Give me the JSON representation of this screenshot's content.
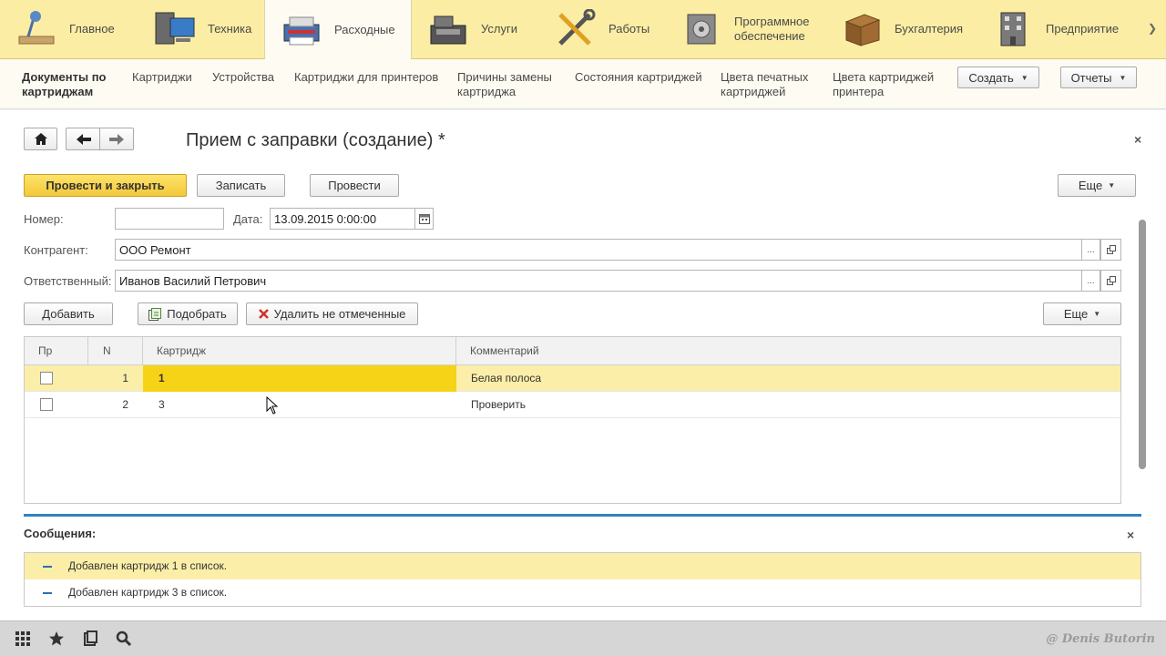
{
  "sections": [
    {
      "label": "Главное",
      "icon": "desk-lamp-icon"
    },
    {
      "label": "Техника",
      "icon": "computer-icon"
    },
    {
      "label": "Расходные",
      "icon": "printer-icon",
      "active": true
    },
    {
      "label": "Услуги",
      "icon": "cash-register-icon"
    },
    {
      "label": "Работы",
      "icon": "tools-icon"
    },
    {
      "label": "Программное\nобеспечение",
      "icon": "software-icon"
    },
    {
      "label": "Бухгалтерия",
      "icon": "archive-box-icon"
    },
    {
      "label": "Предприятие",
      "icon": "building-icon"
    }
  ],
  "navbar": {
    "items": [
      {
        "label": "Документы по\nкартриджам",
        "bold": true
      },
      {
        "label": "Картриджи"
      },
      {
        "label": "Устройства"
      },
      {
        "label": "Картриджи для принтеров"
      },
      {
        "label": "Причины замены\nкартриджа"
      },
      {
        "label": "Состояния картриджей"
      },
      {
        "label": "Цвета печатных\nкартриджей"
      },
      {
        "label": "Цвета картриджей\nпринтера"
      }
    ],
    "create_label": "Создать",
    "reports_label": "Отчеты"
  },
  "form": {
    "title": "Прием с заправки (создание) *",
    "post_close_label": "Провести и закрыть",
    "save_label": "Записать",
    "post_label": "Провести",
    "more_label": "Еще",
    "number_label": "Номер:",
    "number_value": "",
    "date_label": "Дата:",
    "date_value": "13.09.2015  0:00:00",
    "counterparty_label": "Контрагент:",
    "counterparty_value": "ООО Ремонт",
    "responsible_label": "Ответственный:",
    "responsible_value": "Иванов Василий Петрович",
    "add_label": "Добавить",
    "pick_label": "Подобрать",
    "delete_unmarked_label": "Удалить не отмеченные",
    "table_more_label": "Еще",
    "ellipsis": "..."
  },
  "table": {
    "columns": [
      "Пр",
      "N",
      "Картридж",
      "Комментарий"
    ],
    "rows": [
      {
        "checked": false,
        "n": "1",
        "cartridge": "1",
        "comment": "Белая полоса"
      },
      {
        "checked": false,
        "n": "2",
        "cartridge": "3",
        "comment": "Проверить"
      }
    ]
  },
  "messages": {
    "title": "Сообщения:",
    "items": [
      "Добавлен картридж 1 в список.",
      "Добавлен картридж 3 в список."
    ]
  },
  "watermark": "@ Denis Butorin",
  "colors": {
    "sections_bg": "#fbeda3",
    "primary_button": "#f4c83a",
    "selected_row": "#fbeea8",
    "current_cell": "#f7d317",
    "accent_blue": "#2d83c4"
  }
}
